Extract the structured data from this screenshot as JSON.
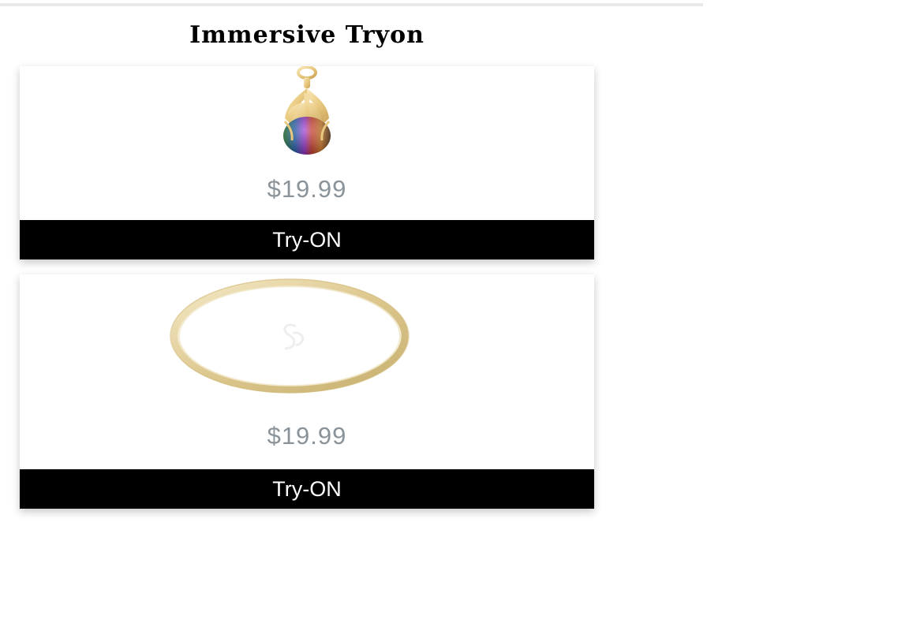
{
  "header": {
    "title": "Immersive Tryon"
  },
  "products": [
    {
      "image_icon": "pendant-icon",
      "price": "$19.99",
      "button_label": "Try-ON"
    },
    {
      "image_icon": "bangle-icon",
      "price": "$19.99",
      "button_label": "Try-ON"
    }
  ],
  "colors": {
    "button_bg": "#000000",
    "button_text": "#ffffff",
    "price_text": "#8a9399",
    "gold": "#e6cf98"
  }
}
